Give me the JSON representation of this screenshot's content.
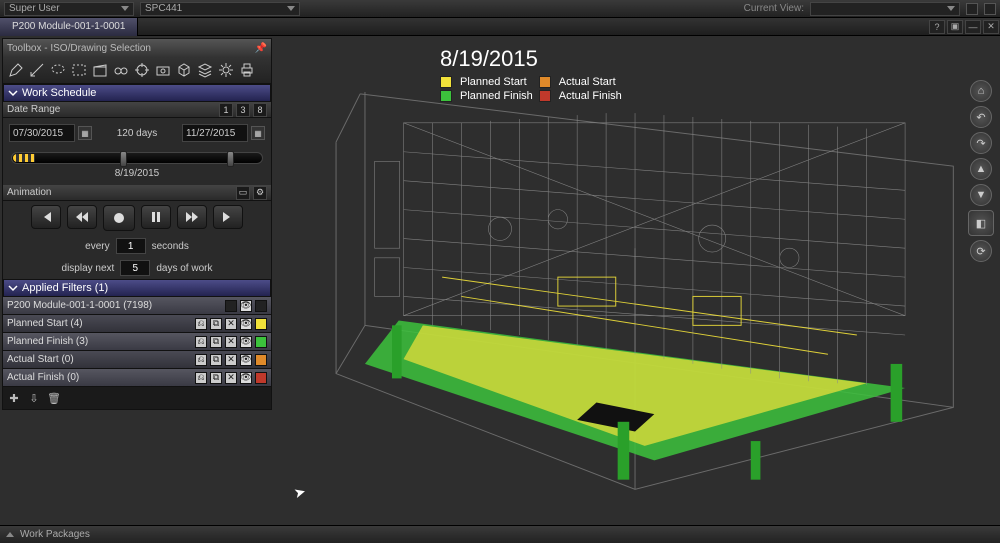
{
  "menubar": {
    "user": "Super User",
    "project": "SPC441",
    "current_view_label": "Current View:"
  },
  "tab": {
    "title": "P200 Module-001-1-0001"
  },
  "toolbox": {
    "title": "Toolbox - ISO/Drawing Selection",
    "work_schedule": {
      "header": "Work Schedule",
      "date_range_label": "Date Range",
      "start_date": "07/30/2015",
      "end_date": "11/27/2015",
      "span_label": "120 days",
      "current_date": "8/19/2015"
    },
    "animation": {
      "label": "Animation",
      "every_label": "every",
      "every_value": "1",
      "every_unit": "seconds",
      "display_label": "display next",
      "display_value": "5",
      "display_unit": "days of work"
    },
    "filters": {
      "header": "Applied Filters (1)",
      "rows": [
        {
          "name": "P200 Module-001-1-0001 (7198)",
          "color": "#222222"
        },
        {
          "name": "Planned Start (4)",
          "color": "#f2e23a"
        },
        {
          "name": "Planned Finish (3)",
          "color": "#3cc23c"
        },
        {
          "name": "Actual Start (0)",
          "color": "#e08a2a"
        },
        {
          "name": "Actual Finish (0)",
          "color": "#c0392b"
        }
      ]
    }
  },
  "viewport": {
    "date": "8/19/2015",
    "legend": {
      "planned_start": "Planned Start",
      "actual_start": "Actual Start",
      "planned_finish": "Planned Finish",
      "actual_finish": "Actual Finish",
      "colors": {
        "planned_start": "#f2e23a",
        "actual_start": "#e08a2a",
        "planned_finish": "#3cc23c",
        "actual_finish": "#c0392b"
      }
    }
  },
  "bottombar": {
    "label": "Work Packages"
  }
}
